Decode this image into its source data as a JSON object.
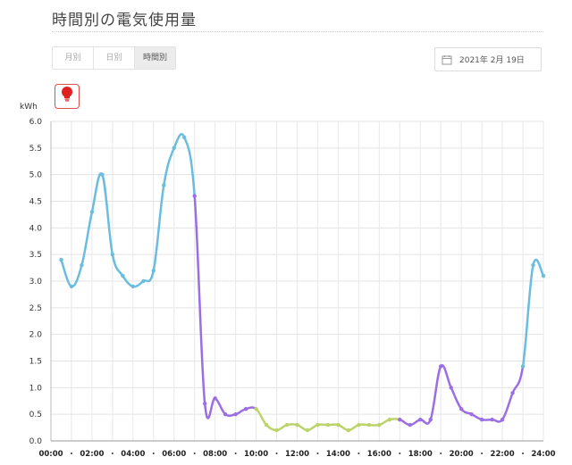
{
  "header": {
    "title": "時間別の電気使用量"
  },
  "tabs": [
    {
      "label": "月別",
      "active": false
    },
    {
      "label": "日別",
      "active": false
    },
    {
      "label": "時間別",
      "active": true
    }
  ],
  "date_picker": {
    "value": "2021年  2月 19日",
    "icon": "calendar-icon"
  },
  "mode_button": {
    "icon": "light-bulb-icon",
    "color": "#e02020"
  },
  "chart_data": {
    "type": "line",
    "title": "",
    "ylabel": "kWh",
    "xlabel": "",
    "ylim": [
      0,
      6
    ],
    "yticks": [
      "0.0",
      "0.5",
      "1.0",
      "1.5",
      "2.0",
      "2.5",
      "3.0",
      "3.5",
      "4.0",
      "4.5",
      "5.0",
      "5.5",
      "6.0"
    ],
    "xlim": [
      0,
      24
    ],
    "xticks": [
      "00:00",
      "02:00",
      "04:00",
      "06:00",
      "08:00",
      "10:00",
      "12:00",
      "14:00",
      "16:00",
      "18:00",
      "20:00",
      "22:00",
      "24:00"
    ],
    "grid": true,
    "x": [
      0.5,
      1.0,
      1.5,
      2.0,
      2.5,
      3.0,
      3.5,
      4.0,
      4.5,
      5.0,
      5.5,
      6.0,
      6.5,
      7.0,
      7.5,
      8.0,
      8.5,
      9.0,
      9.5,
      10.0,
      10.5,
      11.0,
      11.5,
      12.0,
      12.5,
      13.0,
      13.5,
      14.0,
      14.5,
      15.0,
      15.5,
      16.0,
      16.5,
      17.0,
      17.5,
      18.0,
      18.5,
      19.0,
      19.5,
      20.0,
      20.5,
      21.0,
      21.5,
      22.0,
      22.5,
      23.0,
      23.5,
      24.0
    ],
    "values": [
      3.4,
      2.9,
      3.3,
      4.3,
      5.0,
      3.5,
      3.1,
      2.9,
      3.0,
      3.2,
      4.8,
      5.5,
      5.7,
      4.6,
      0.7,
      0.8,
      0.5,
      0.5,
      0.6,
      0.6,
      0.3,
      0.2,
      0.3,
      0.3,
      0.2,
      0.3,
      0.3,
      0.3,
      0.2,
      0.3,
      0.3,
      0.3,
      0.4,
      0.4,
      0.3,
      0.4,
      0.4,
      1.4,
      1.0,
      0.6,
      0.5,
      0.4,
      0.4,
      0.4,
      0.9,
      1.4,
      3.3,
      3.1
    ],
    "segments": [
      {
        "from_index": 0,
        "to_index": 13,
        "color": "#6bbde0",
        "label": ""
      },
      {
        "from_index": 13,
        "to_index": 19,
        "color": "#9b6fe3",
        "label": ""
      },
      {
        "from_index": 19,
        "to_index": 33,
        "color": "#bcd36a",
        "label": ""
      },
      {
        "from_index": 33,
        "to_index": 45,
        "color": "#9b6fe3",
        "label": ""
      },
      {
        "from_index": 45,
        "to_index": 47,
        "color": "#6bbde0",
        "label": ""
      }
    ]
  }
}
